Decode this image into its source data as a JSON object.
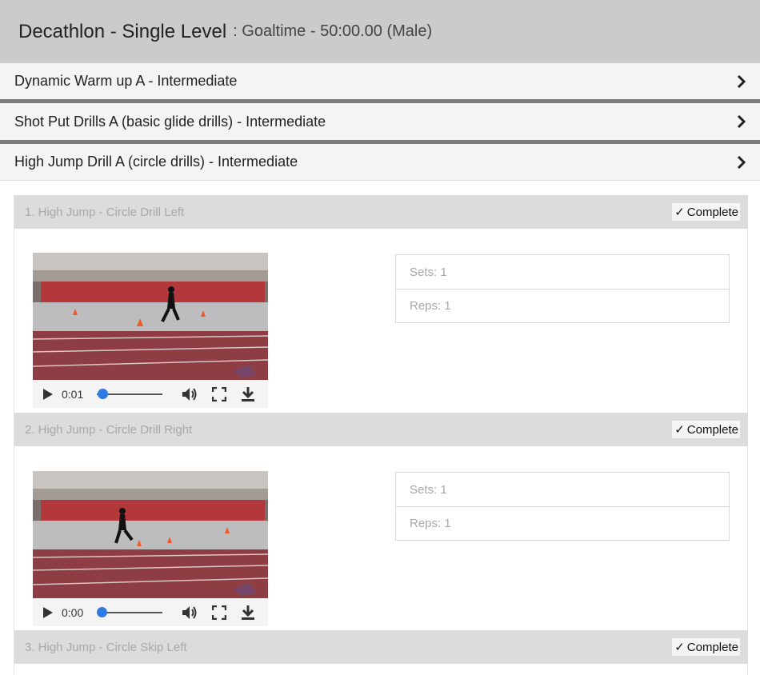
{
  "header": {
    "title": "Decathlon - Single Level",
    "subtitle": ": Goaltime - 50:00.00 (Male)"
  },
  "accordion": [
    {
      "label": "Dynamic Warm up A - Intermediate"
    },
    {
      "label": "Shot Put Drills A (basic glide drills) - Intermediate"
    },
    {
      "label": "High Jump Drill A (circle drills) - Intermediate"
    }
  ],
  "exercises": [
    {
      "title": "1. High Jump - Circle Drill Left",
      "complete_label": "Complete",
      "video_time": "0:01",
      "seek_progress": 0.02,
      "sets": "Sets: 1",
      "reps": "Reps: 1"
    },
    {
      "title": "2. High Jump - Circle Drill Right",
      "complete_label": "Complete",
      "video_time": "0:00",
      "seek_progress": 0.0,
      "sets": "Sets: 1",
      "reps": "Reps: 1"
    },
    {
      "title": "3. High Jump - Circle Skip Left",
      "complete_label": "Complete"
    }
  ],
  "icons": {
    "chevron": "chevron-right-icon",
    "check": "check-icon",
    "play": "play-icon",
    "volume": "volume-icon",
    "fullscreen": "fullscreen-icon",
    "download": "download-icon"
  },
  "colors": {
    "header_bg": "#cbcbcb",
    "accordion_bg": "#f4f4f4",
    "separator": "#7b7b7b",
    "exercise_header_bg": "#dcdcdc",
    "seek_knob": "#2f7ae5",
    "muted_text": "#a8a8a8"
  }
}
